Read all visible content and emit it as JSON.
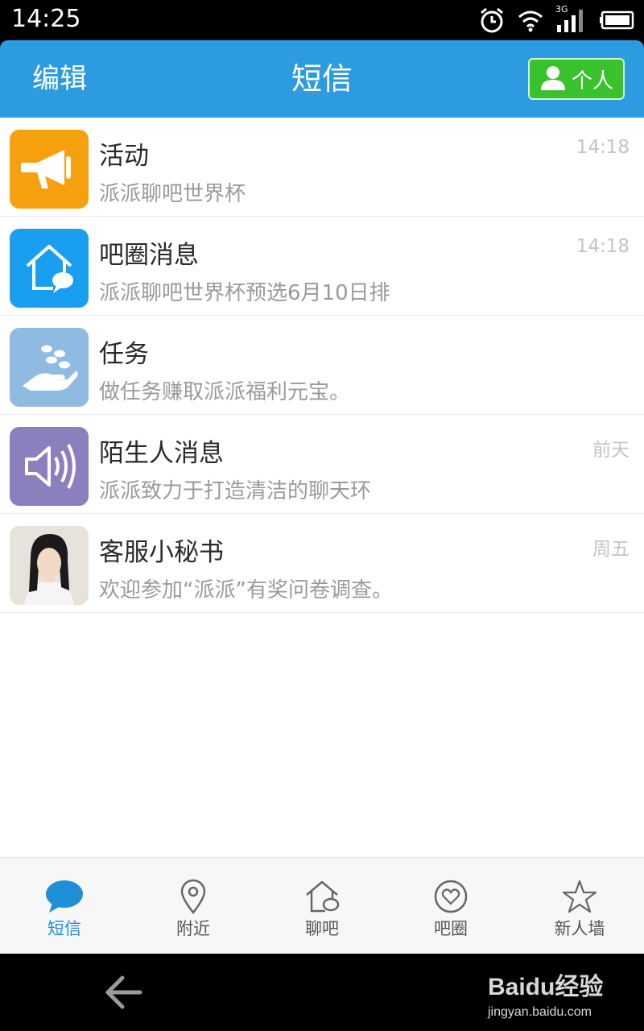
{
  "status_bar": {
    "time": "14:25",
    "network_label": "3G",
    "icons": [
      "alarm-icon",
      "wifi-icon",
      "signal-icon",
      "battery-icon"
    ]
  },
  "header": {
    "edit_label": "编辑",
    "title": "短信",
    "personal_label": "个人",
    "bg_color": "#2d9be0",
    "personal_btn_color": "#39c22d"
  },
  "messages": [
    {
      "title": "活动",
      "preview": "派派聊吧世界杯",
      "time": "14:18",
      "icon": "megaphone-icon",
      "icon_color": "#f5a00c"
    },
    {
      "title": "吧圈消息",
      "preview": "派派聊吧世界杯预选6月10日排",
      "time": "14:18",
      "icon": "house-chat-icon",
      "icon_color": "#199fef"
    },
    {
      "title": "任务",
      "preview": "做任务赚取派派福利元宝。",
      "time": "",
      "icon": "hand-coins-icon",
      "icon_color": "#8fbbe2"
    },
    {
      "title": "陌生人消息",
      "preview": "派派致力于打造清洁的聊天环",
      "time": "前天",
      "icon": "speaker-icon",
      "icon_color": "#8c7fbd"
    },
    {
      "title": "客服小秘书",
      "preview": "欢迎参加“派派”有奖问卷调查。",
      "time": "周五",
      "icon": "avatar-photo",
      "icon_color": "#d9d2cb"
    }
  ],
  "tabs": [
    {
      "label": "短信",
      "icon": "chat-bubble-icon",
      "active": true
    },
    {
      "label": "附近",
      "icon": "location-pin-icon",
      "active": false
    },
    {
      "label": "聊吧",
      "icon": "house-chat-icon",
      "active": false
    },
    {
      "label": "吧圈",
      "icon": "heart-circle-icon",
      "active": false
    },
    {
      "label": "新人墙",
      "icon": "star-icon",
      "active": false
    }
  ],
  "watermark": {
    "logo": "Baidu经验",
    "domain": "jingyan.baidu.com"
  },
  "colors": {
    "active_tab": "#1f8fd8",
    "inactive_tab": "#555555"
  }
}
